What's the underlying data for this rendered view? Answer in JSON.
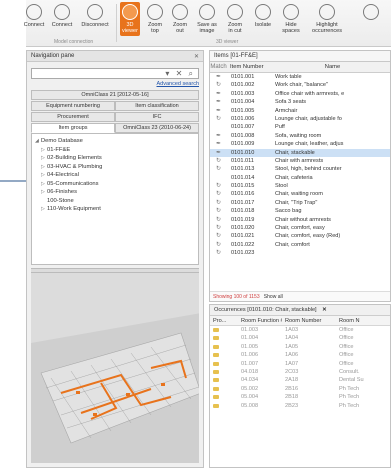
{
  "ribbon": {
    "buttons": [
      {
        "label": "Connect",
        "icon": "plug-icon"
      },
      {
        "label": "Connect",
        "icon": "connect-icon"
      },
      {
        "label": "Disconnect",
        "icon": "disconnect-icon"
      },
      {
        "label": "3D\nviewer",
        "icon": "3d-icon",
        "active": true
      },
      {
        "label": "Zoom\ntop",
        "icon": "zoom-top-icon"
      },
      {
        "label": "Zoom\nout",
        "icon": "zoom-out-icon"
      },
      {
        "label": "Save as\nimage",
        "icon": "save-image-icon"
      },
      {
        "label": "Zoom\nin cut",
        "icon": "zoom-in-cut-icon"
      },
      {
        "label": "Isolate",
        "icon": "isolate-icon"
      },
      {
        "label": "Hide\nspaces",
        "icon": "hide-spaces-icon"
      },
      {
        "label": "Highlight\noccurrences",
        "icon": "highlight-icon"
      }
    ],
    "groups": {
      "model_connection": "Model connection",
      "viewer_3d": "3D viewer"
    },
    "active_color": "#e8731c"
  },
  "navpane": {
    "title": "Navigation pane",
    "pin": "✕",
    "search_icons": "▾ ✕ ⌕",
    "advanced_search": "Advanced search",
    "classification": "OmniClass 21 [2012-05-16]",
    "tabs_row1": [
      "Equipment numbering",
      "Item classification"
    ],
    "tabs_row2": [
      "Procurement",
      "IFC"
    ],
    "tabs_row3": [
      "Item groups",
      "OmniClass 23 (2010-06-24)"
    ],
    "tree": [
      {
        "text": "Demo Database",
        "arrow": "◢",
        "indent": 0
      },
      {
        "text": "01-FF&E",
        "arrow": "▷",
        "indent": 1
      },
      {
        "text": "02-Building Elements",
        "arrow": "▷",
        "indent": 1
      },
      {
        "text": "03-HVAC & Plumbing",
        "arrow": "▷",
        "indent": 1
      },
      {
        "text": "04-Electrical",
        "arrow": "▷",
        "indent": 1
      },
      {
        "text": "05-Communications",
        "arrow": "▷",
        "indent": 1
      },
      {
        "text": "06-Finishes",
        "arrow": "▷",
        "indent": 1
      },
      {
        "text": "100-Stone",
        "arrow": "",
        "indent": 1
      },
      {
        "text": "110-Work Equipment",
        "arrow": "▷",
        "indent": 1
      }
    ]
  },
  "items": {
    "title": "Items [01-FF&E]",
    "columns": {
      "match": "Match",
      "number": "Item Number",
      "name": "Name"
    },
    "rows": [
      {
        "match": "✒",
        "number": "0101.001",
        "name": "Work table"
      },
      {
        "match": "↻",
        "number": "0101.002",
        "name": "Work chair, \"balance\""
      },
      {
        "match": "✒",
        "number": "0101.003",
        "name": "Office chair with armrests, e"
      },
      {
        "match": "✒",
        "number": "0101.004",
        "name": "Sofa 3 seats"
      },
      {
        "match": "✒",
        "number": "0101.005",
        "name": "Armchair"
      },
      {
        "match": "↻",
        "number": "0101.006",
        "name": "Lounge chair, adjustable fo"
      },
      {
        "match": "",
        "number": "0101.007",
        "name": "Puff"
      },
      {
        "match": "✒",
        "number": "0101.008",
        "name": "Sofa, waiting room"
      },
      {
        "match": "✒",
        "number": "0101.009",
        "name": "Lounge chair, leather, adjus"
      },
      {
        "match": "✒",
        "number": "0101.010",
        "name": "Chair, stackable",
        "selected": true
      },
      {
        "match": "↻",
        "number": "0101.011",
        "name": "Chair with armrests"
      },
      {
        "match": "↻",
        "number": "0101.013",
        "name": "Stool, high, behind counter"
      },
      {
        "match": "",
        "number": "0101.014",
        "name": "Chair, cafeteria"
      },
      {
        "match": "↻",
        "number": "0101.015",
        "name": "Stool"
      },
      {
        "match": "↻",
        "number": "0101.016",
        "name": "Chair, waiting room"
      },
      {
        "match": "↻",
        "number": "0101.017",
        "name": "Chair, \"Trip Trap\""
      },
      {
        "match": "↻",
        "number": "0101.018",
        "name": "Sacco bag"
      },
      {
        "match": "↻",
        "number": "0101.019",
        "name": "Chair without armrests"
      },
      {
        "match": "↻",
        "number": "0101.020",
        "name": "Chair, comfort, easy"
      },
      {
        "match": "↻",
        "number": "0101.021",
        "name": "Chair, comfort, easy (Red)"
      },
      {
        "match": "↻",
        "number": "0101.022",
        "name": "Chair, comfort"
      },
      {
        "match": "↻",
        "number": "0101.023",
        "name": ""
      }
    ],
    "footer_count": "Showing 100 of 1153",
    "footer_link": "Show all"
  },
  "occurrences": {
    "title": "Occurrences [0101.010: Chair, stackable]",
    "close": "✕",
    "columns": [
      "Pro...",
      "Room Function #",
      "Room Number",
      "Room N"
    ],
    "rows": [
      {
        "fn": "01.003",
        "num": "1A03",
        "name": "Office"
      },
      {
        "fn": "01.004",
        "num": "1A04",
        "name": "Office"
      },
      {
        "fn": "01.005",
        "num": "1A05",
        "name": "Office"
      },
      {
        "fn": "01.006",
        "num": "1A06",
        "name": "Office"
      },
      {
        "fn": "01.007",
        "num": "1A07",
        "name": "Office"
      },
      {
        "fn": "04.018",
        "num": "2C03",
        "name": "Consult."
      },
      {
        "fn": "04.034",
        "num": "2A18",
        "name": "Dental Su"
      },
      {
        "fn": "05.002",
        "num": "2B16",
        "name": "Ph Tech"
      },
      {
        "fn": "05.004",
        "num": "2B18",
        "name": "Ph Tech"
      },
      {
        "fn": "05.008",
        "num": "2B23",
        "name": "Ph Tech"
      }
    ]
  }
}
